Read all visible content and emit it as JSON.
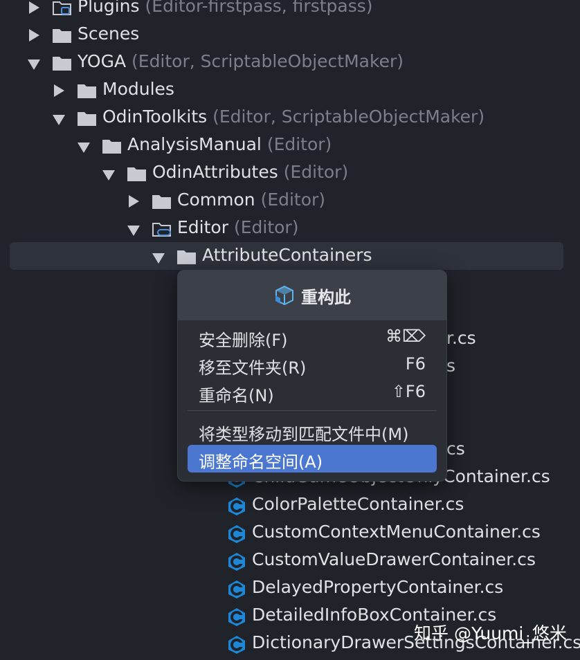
{
  "tree": {
    "rows": [
      {
        "name": "Plugins",
        "hint": "(Editor-firstpass, firstpass)",
        "expanded": false
      },
      {
        "name": "Scenes",
        "hint": "",
        "expanded": false
      },
      {
        "name": "YOGA",
        "hint": "(Editor, ScriptableObjectMaker)",
        "expanded": true
      },
      {
        "name": "Modules",
        "hint": "",
        "expanded": false
      },
      {
        "name": "OdinToolkits",
        "hint": "(Editor, ScriptableObjectMaker)",
        "expanded": true
      },
      {
        "name": "AnalysisManual",
        "hint": "(Editor)",
        "expanded": true
      },
      {
        "name": "OdinAttributes",
        "hint": "(Editor)",
        "expanded": true
      },
      {
        "name": "Common",
        "hint": "(Editor)",
        "expanded": false
      },
      {
        "name": "Editor",
        "hint": "(Editor)",
        "expanded": true
      },
      {
        "name": "AttributeContainers",
        "hint": "",
        "expanded": true
      }
    ],
    "partial_files": [
      "r.cs",
      "s",
      "cs",
      "ChildGameObjectOnlyContainer.cs"
    ],
    "files": [
      "ColorPaletteContainer.cs",
      "CustomContextMenuContainer.cs",
      "CustomValueDrawerContainer.cs",
      "DelayedPropertyContainer.cs",
      "DetailedInfoBoxContainer.cs",
      "DictionaryDrawerSettingsContainer.cs"
    ]
  },
  "menu": {
    "title": "重构此",
    "items": [
      {
        "label": "安全删除(F)",
        "shortcut": "⌘⌦"
      },
      {
        "label": "移至文件夹(R)",
        "shortcut": "F6"
      },
      {
        "label": "重命名(N)",
        "shortcut": "⇧F6"
      },
      {
        "label": "将类型移动到匹配文件中(M)",
        "shortcut": ""
      },
      {
        "label": "调整命名空间(A)",
        "shortcut": ""
      }
    ],
    "active_index": 4
  },
  "watermark": "知乎 @Yuumi_悠米",
  "colors": {
    "background": "#20232a",
    "accent": "#4b77d1",
    "csharp_icon": "#1e88d8",
    "hint": "#7a7f88"
  }
}
